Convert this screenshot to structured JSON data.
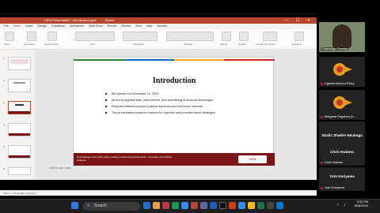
{
  "ppt": {
    "title": "CIPA Presentation - Introduction.pptx",
    "saved": "Saved",
    "menu": [
      "File",
      "Home",
      "Insert",
      "Design",
      "Transitions",
      "Animations",
      "Slide Show",
      "Record",
      "Review",
      "View",
      "Help",
      "Acrobat"
    ],
    "active_menu": "Home",
    "ribbon": [
      "Paste",
      "New Slide",
      "Reuse Slides",
      "Font",
      "Paragraph",
      "Drawing",
      "Editing",
      "Dictate",
      "Create and Share",
      "Designer"
    ],
    "statusbar": "Slide 3 of 16    English (Uganda)"
  },
  "slide": {
    "title": "Introduction",
    "bullets": [
      "Bill rejected on November 14, 2023",
      "Aimed to regulate sale, manufacture, and advertising of alcoholic beverages",
      "Rejection reflects complex political dynamics and economic interests",
      "This presentation explores reasons for rejection and provides future strategies"
    ],
    "footer_text": "Contributing to the public policy making process through Research, Innovation and Critical Analysis.",
    "logo_text": "CIPA",
    "colorbar": [
      "#2e7d32",
      "#1565c0",
      "#f9a825",
      "#c62828"
    ]
  },
  "notes": "Click to add notes",
  "participants": [
    {
      "name": "Chamongu Timothy",
      "type": "video"
    },
    {
      "name": "Uganda Alcohol Policy",
      "type": "logo"
    },
    {
      "name": "Margaret Ruganza (U...",
      "type": "logo"
    },
    {
      "name": "Shafic Shakim Nsubuga",
      "label": "Shafic Shakim Nsubu...",
      "type": "name"
    },
    {
      "name": "Chris Kwizera",
      "label": "Chris Kwizera",
      "type": "name"
    },
    {
      "name": "Yuto Koriyama",
      "label": "Yuto Koriyama",
      "type": "name"
    }
  ],
  "taskbar": {
    "search_placeholder": "Search",
    "time": "2:31 PM",
    "date": "8/28/2024"
  }
}
